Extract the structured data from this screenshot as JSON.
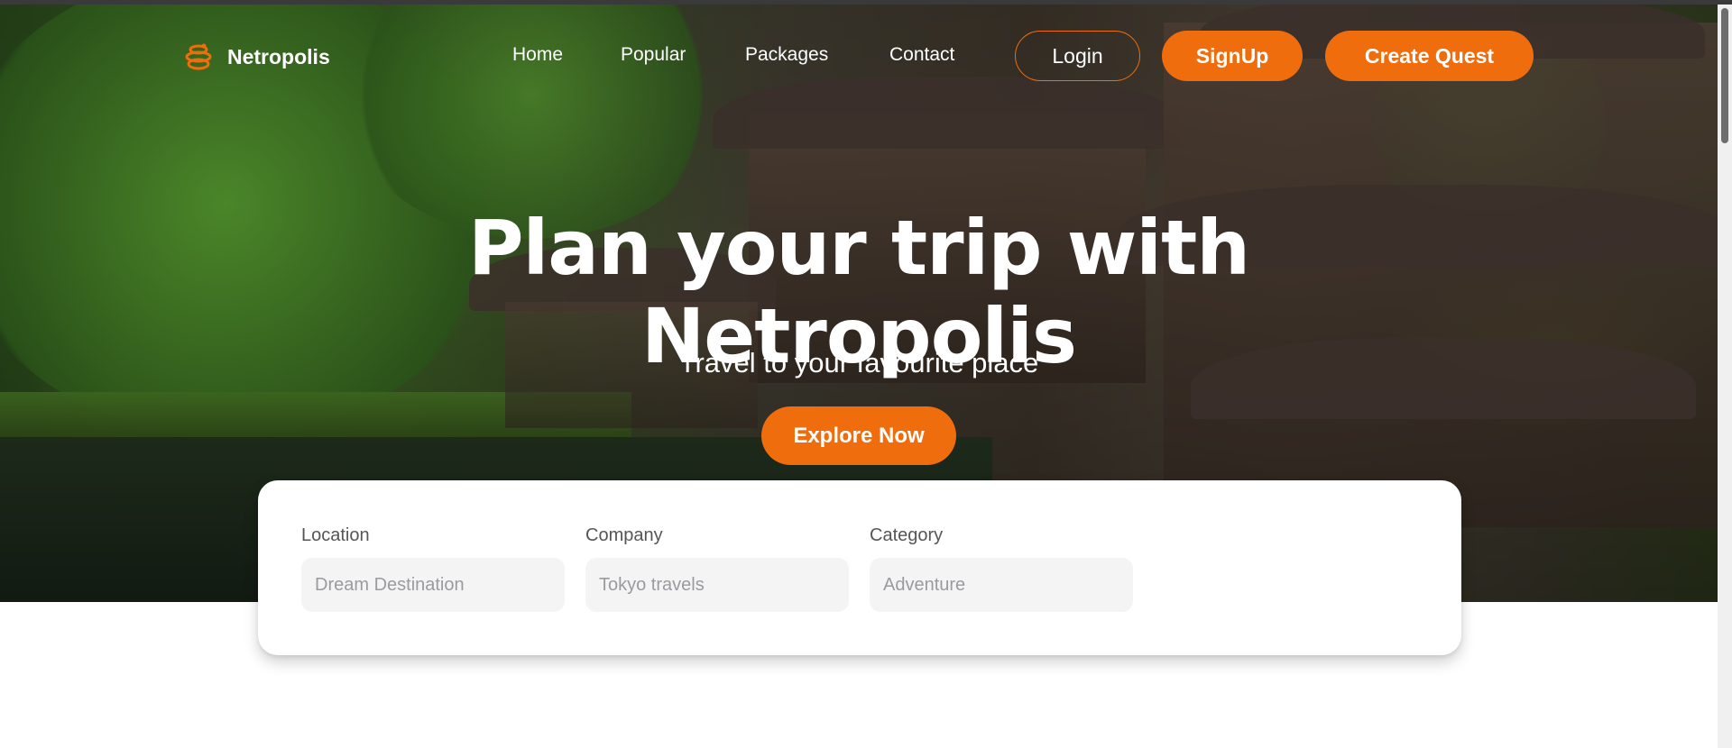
{
  "brand": {
    "name": "Netropolis",
    "icon": "globe-stack-icon",
    "accent_color": "#f06d0d"
  },
  "nav": {
    "links": [
      "Home",
      "Popular",
      "Packages",
      "Contact"
    ],
    "login_label": "Login",
    "signup_label": "SignUp",
    "create_label": "Create Quest"
  },
  "hero": {
    "title_line1": "Plan your trip with",
    "title_line2": "Netropolis",
    "subtitle": "Travel to your favourite place",
    "cta_label": "Explore Now"
  },
  "search": {
    "location_label": "Location",
    "location_placeholder": "Dream Destination",
    "company_label": "Company",
    "company_placeholder": "Tokyo travels",
    "category_label": "Category",
    "category_placeholder": "Adventure"
  }
}
